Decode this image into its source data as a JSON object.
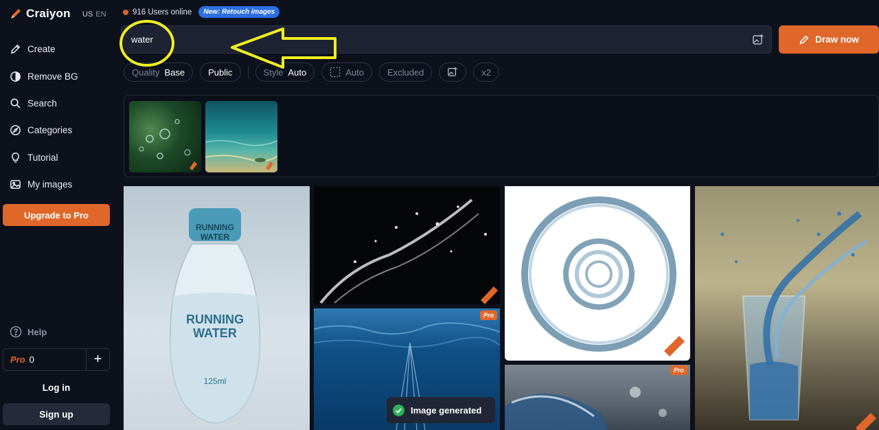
{
  "brand": {
    "name": "Craiyon",
    "lang_country": "US",
    "lang_code": "EN",
    "accent": "#e0672a"
  },
  "sidebar": {
    "items": [
      {
        "label": "Create",
        "icon": "pencil-icon"
      },
      {
        "label": "Remove BG",
        "icon": "half-circle-icon"
      },
      {
        "label": "Search",
        "icon": "search-icon"
      },
      {
        "label": "Categories",
        "icon": "compass-icon"
      },
      {
        "label": "Tutorial",
        "icon": "lightbulb-icon"
      },
      {
        "label": "My images",
        "icon": "image-icon"
      }
    ],
    "upgrade_label": "Upgrade to Pro",
    "help_label": "Help",
    "pro_label": "Pro",
    "pro_count": "0",
    "login_label": "Log in",
    "signup_label": "Sign up"
  },
  "status": {
    "users_online": "916 Users online",
    "badge": "New: Retouch images"
  },
  "prompt": {
    "value": "water"
  },
  "draw_label": "Draw now",
  "options": {
    "quality_key": "Quality",
    "quality_value": "Base",
    "visibility": "Public",
    "style_key": "Style",
    "style_value": "Auto",
    "ratio": "Auto",
    "excluded": "Excluded",
    "multiplier": "x2"
  },
  "grid": {
    "pro_tag": "Pro"
  },
  "toast": {
    "text": "Image generated"
  }
}
